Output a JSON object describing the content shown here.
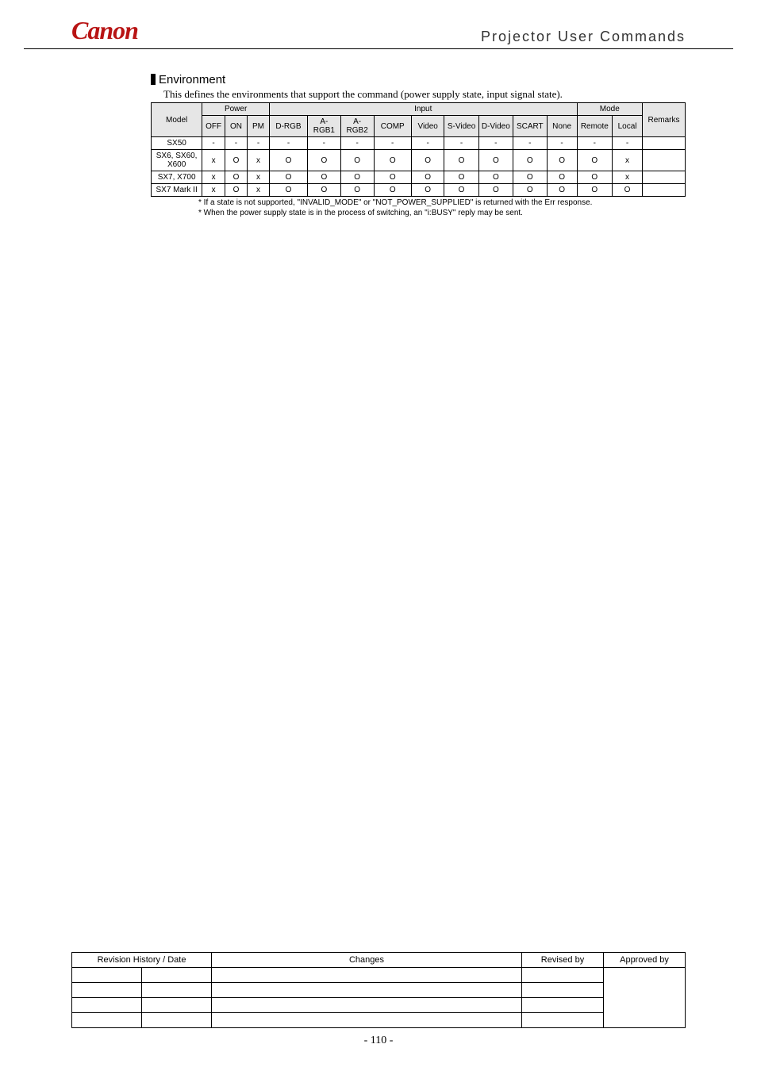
{
  "header": {
    "logo": "Canon",
    "title": "Projector User Commands"
  },
  "section": {
    "title": "Environment",
    "intro": "This defines the environments that support the command (power supply state, input signal state)."
  },
  "env_table": {
    "headers": {
      "model": "Model",
      "power": "Power",
      "input": "Input",
      "mode": "Mode",
      "remarks": "Remarks",
      "off": "OFF",
      "on": "ON",
      "pm": "PM",
      "drgb": "D-RGB",
      "argb1": "A-RGB1",
      "argb2": "A-RGB2",
      "comp": "COMP",
      "video": "Video",
      "svideo": "S-Video",
      "dvideo": "D-Video",
      "scart": "SCART",
      "none": "None",
      "remote": "Remote",
      "local": "Local"
    },
    "rows": [
      {
        "model": "SX50",
        "off": "-",
        "on": "-",
        "pm": "-",
        "drgb": "-",
        "argb1": "-",
        "argb2": "-",
        "comp": "-",
        "video": "-",
        "svideo": "-",
        "dvideo": "-",
        "scart": "-",
        "none": "-",
        "remote": "-",
        "local": "-",
        "remarks": ""
      },
      {
        "model": "SX6, SX60, X600",
        "off": "x",
        "on": "O",
        "pm": "x",
        "drgb": "O",
        "argb1": "O",
        "argb2": "O",
        "comp": "O",
        "video": "O",
        "svideo": "O",
        "dvideo": "O",
        "scart": "O",
        "none": "O",
        "remote": "O",
        "local": "x",
        "remarks": ""
      },
      {
        "model": "SX7, X700",
        "off": "x",
        "on": "O",
        "pm": "x",
        "drgb": "O",
        "argb1": "O",
        "argb2": "O",
        "comp": "O",
        "video": "O",
        "svideo": "O",
        "dvideo": "O",
        "scart": "O",
        "none": "O",
        "remote": "O",
        "local": "x",
        "remarks": ""
      },
      {
        "model": "SX7 Mark II",
        "off": "x",
        "on": "O",
        "pm": "x",
        "drgb": "O",
        "argb1": "O",
        "argb2": "O",
        "comp": "O",
        "video": "O",
        "svideo": "O",
        "dvideo": "O",
        "scart": "O",
        "none": "O",
        "remote": "O",
        "local": "O",
        "remarks": ""
      }
    ]
  },
  "notes": {
    "n1": "*  If a state is not supported, \"INVALID_MODE\" or \"NOT_POWER_SUPPLIED\" is returned with the Err response.",
    "n2": "*  When the power supply state is in the process of switching, an \"i:BUSY\" reply may be sent."
  },
  "revision": {
    "headers": {
      "rhd": "Revision History / Date",
      "changes": "Changes",
      "revised": "Revised by",
      "approved": "Approved by"
    }
  },
  "page": "- 110 -"
}
